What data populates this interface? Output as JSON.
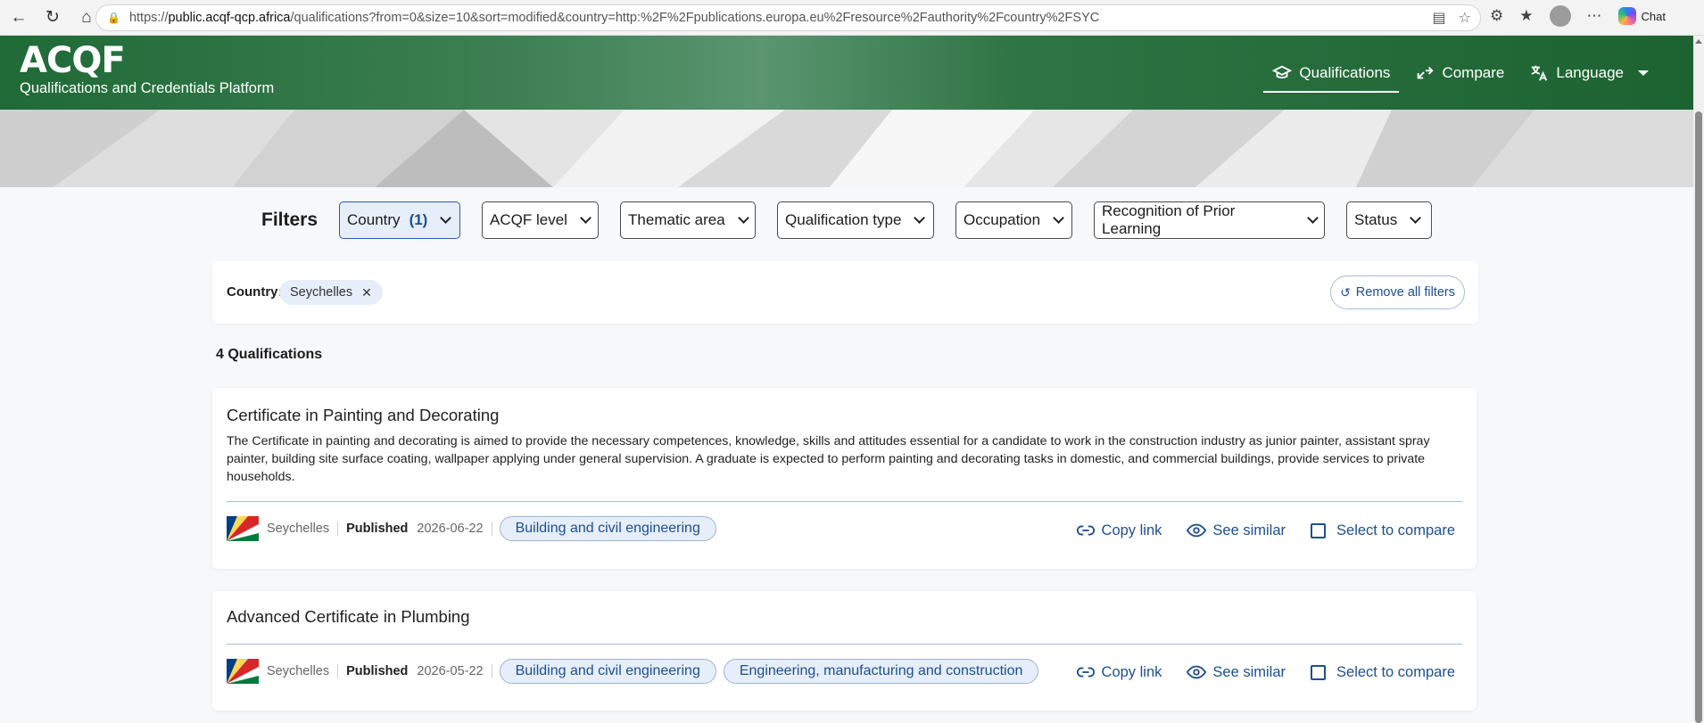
{
  "browser": {
    "url_prefix": "https://",
    "url_domain": "public.acqf-qcp.africa",
    "url_path": "/qualifications?from=0&size=10&sort=modified&country=http:%2F%2Fpublications.europa.eu%2Fresource%2Fauthority%2Fcountry%2FSYC",
    "chat_label": "Chat"
  },
  "header": {
    "logo": "ACQF",
    "tagline": "Qualifications and Credentials Platform",
    "nav": [
      {
        "label": "Qualifications",
        "icon": "graduation-cap-icon",
        "active": true
      },
      {
        "label": "Compare",
        "icon": "compare-arrows-icon"
      },
      {
        "label": "Language",
        "icon": "translate-icon"
      }
    ]
  },
  "filters": {
    "title": "Filters",
    "buttons": [
      {
        "label": "Country",
        "count": "(1)",
        "active": true
      },
      {
        "label": "ACQF level"
      },
      {
        "label": "Thematic area"
      },
      {
        "label": "Qualification type"
      },
      {
        "label": "Occupation"
      },
      {
        "label": "Recognition of Prior Learning"
      },
      {
        "label": "Status"
      }
    ]
  },
  "active_filters": {
    "label": "Country:",
    "chip": "Seychelles",
    "chip_close": "✕",
    "remove_all": "Remove all filters"
  },
  "results": {
    "count_label": "4 Qualifications",
    "actions": {
      "copy": "Copy link",
      "similar": "See similar",
      "compare": "Select to compare"
    },
    "items": [
      {
        "title": "Certificate in Painting and Decorating",
        "description": "The Certificate in painting and decorating is aimed to provide the necessary competences, knowledge, skills and attitudes essential for a candidate to work in the construction industry as junior painter, assistant spray painter, building site surface coating, wallpaper applying under general supervision. A graduate is expected to perform painting and decorating tasks in domestic, and commercial buildings, provide services to private households.",
        "country": "Seychelles",
        "status": "Published",
        "date": "2026-06-22",
        "tags": [
          "Building and civil engineering"
        ]
      },
      {
        "title": "Advanced Certificate in Plumbing",
        "description": "",
        "country": "Seychelles",
        "status": "Published",
        "date": "2026-05-22",
        "tags": [
          "Building and civil engineering",
          "Engineering, manufacturing and construction"
        ]
      }
    ]
  },
  "colors": {
    "header_green": "#1f6a37",
    "accent_blue": "#1d4f91",
    "chip_bg": "#e6eef9"
  }
}
